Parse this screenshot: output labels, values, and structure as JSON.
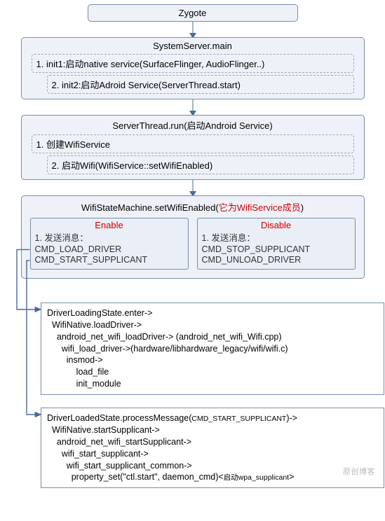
{
  "zygote": {
    "title": "Zygote"
  },
  "systemServer": {
    "title": "SystemServer.main",
    "step1": "1. init1:启动native service(SurfaceFlinger, AudioFlinger..)",
    "step2": "2. init2:启动Adroid Service(ServerThread.start)"
  },
  "serverThread": {
    "title": "ServerThread.run(启动Android Service)",
    "step1": "1. 创建WifiService",
    "step2": "2. 启动Wifi(WifiService::setWifiEnabled)"
  },
  "wifiStateMachine": {
    "title_prefix": "WifiStateMachine.setWifiEnabled(",
    "title_red": "它为WifiService成员",
    "title_suffix": ")",
    "enable": {
      "hdr": "Enable",
      "line1": "1. 发送消息：",
      "line2": "CMD_LOAD_DRIVER",
      "line3": "CMD_START_SUPPLICANT"
    },
    "disable": {
      "hdr": "Disable",
      "line1": "1. 发送消息：",
      "line2": "CMD_STOP_SUPPLICANT",
      "line3": "CMD_UNLOAD_DRIVER"
    }
  },
  "driverLoading": {
    "text": "DriverLoadingState.enter->\n  WifiNative.loadDriver->\n    android_net_wifi_loadDriver-> (android_net_wifi_Wifi.cpp)\n      wifi_load_driver->(hardware/libhardware_legacy/wifi/wifi.c)\n        insmod->\n            load_file\n            init_module"
  },
  "driverLoaded": {
    "line1": "DriverLoadedState.processMessage(",
    "line1_small": "CMD_START_SUPPLICANT",
    "line1_suffix": ")->",
    "rest": "  WifiNative.startSupplicant->\n    android_net_wifi_startSupplicant->\n      wifi_start_supplicant->\n        wifi_start_supplicant_common->\n          property_set(\"ctl.start\", daemon_cmd)<",
    "final_small": "启动wpa_supplicant",
    "final_suffix": ">"
  },
  "watermark": "原创博客"
}
